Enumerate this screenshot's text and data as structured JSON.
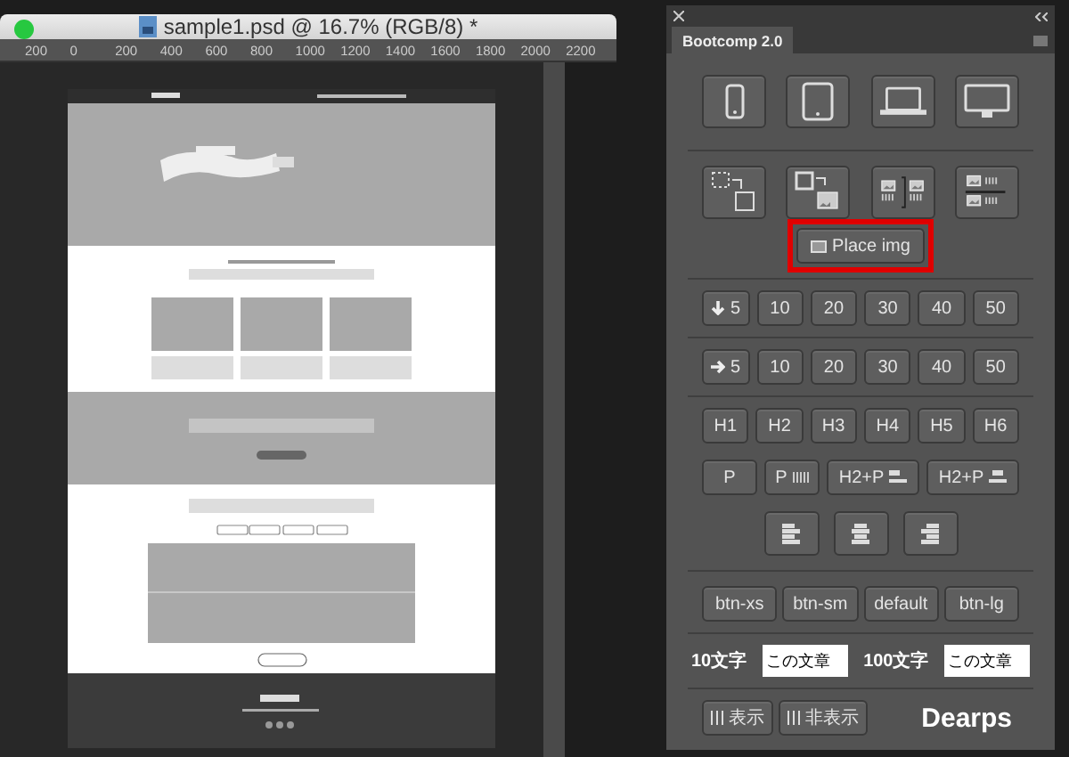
{
  "document_window": {
    "title": "sample1.psd @ 16.7% (RGB/8) *",
    "ruler_labels": [
      "200",
      "0",
      "200",
      "400",
      "600",
      "800",
      "1000",
      "1200",
      "1400",
      "1600",
      "1800",
      "2000",
      "2200"
    ]
  },
  "panel": {
    "tab": "Bootcomp 2.0",
    "device_buttons": [
      {
        "kind": "phone"
      },
      {
        "kind": "tablet"
      },
      {
        "kind": "laptop"
      },
      {
        "kind": "desktop"
      }
    ],
    "layout_buttons": [
      {
        "kind": "wrap"
      },
      {
        "kind": "replace"
      },
      {
        "kind": "side"
      },
      {
        "kind": "stack"
      }
    ],
    "place_button": {
      "label": "Place img",
      "highlighted": true
    },
    "margin_rows": [
      {
        "kind": "down",
        "buttons": [
          "5",
          "10",
          "20",
          "30",
          "40",
          "50"
        ]
      },
      {
        "kind": "right",
        "buttons": [
          "5",
          "10",
          "20",
          "30",
          "40",
          "50"
        ]
      }
    ],
    "heading_buttons": [
      "H1",
      "H2",
      "H3",
      "H4",
      "H5",
      "H6"
    ],
    "paragraph_buttons": [
      {
        "label": "P",
        "kind": "plain"
      },
      {
        "label": "P",
        "kind": "lines"
      },
      {
        "label": "H2+P",
        "kind": "left"
      },
      {
        "label": "H2+P",
        "kind": "center"
      }
    ],
    "align_buttons": [
      {
        "kind": "left"
      },
      {
        "kind": "center"
      },
      {
        "kind": "right"
      }
    ],
    "size_buttons": [
      "btn-xs",
      "btn-sm",
      "default",
      "btn-lg"
    ],
    "text_fields": [
      {
        "label": "10文字",
        "value": "この文章"
      },
      {
        "label": "100文字",
        "value": "この文章"
      }
    ],
    "visibility_buttons": [
      "表示",
      "非表示"
    ],
    "brand": "Dearps"
  }
}
